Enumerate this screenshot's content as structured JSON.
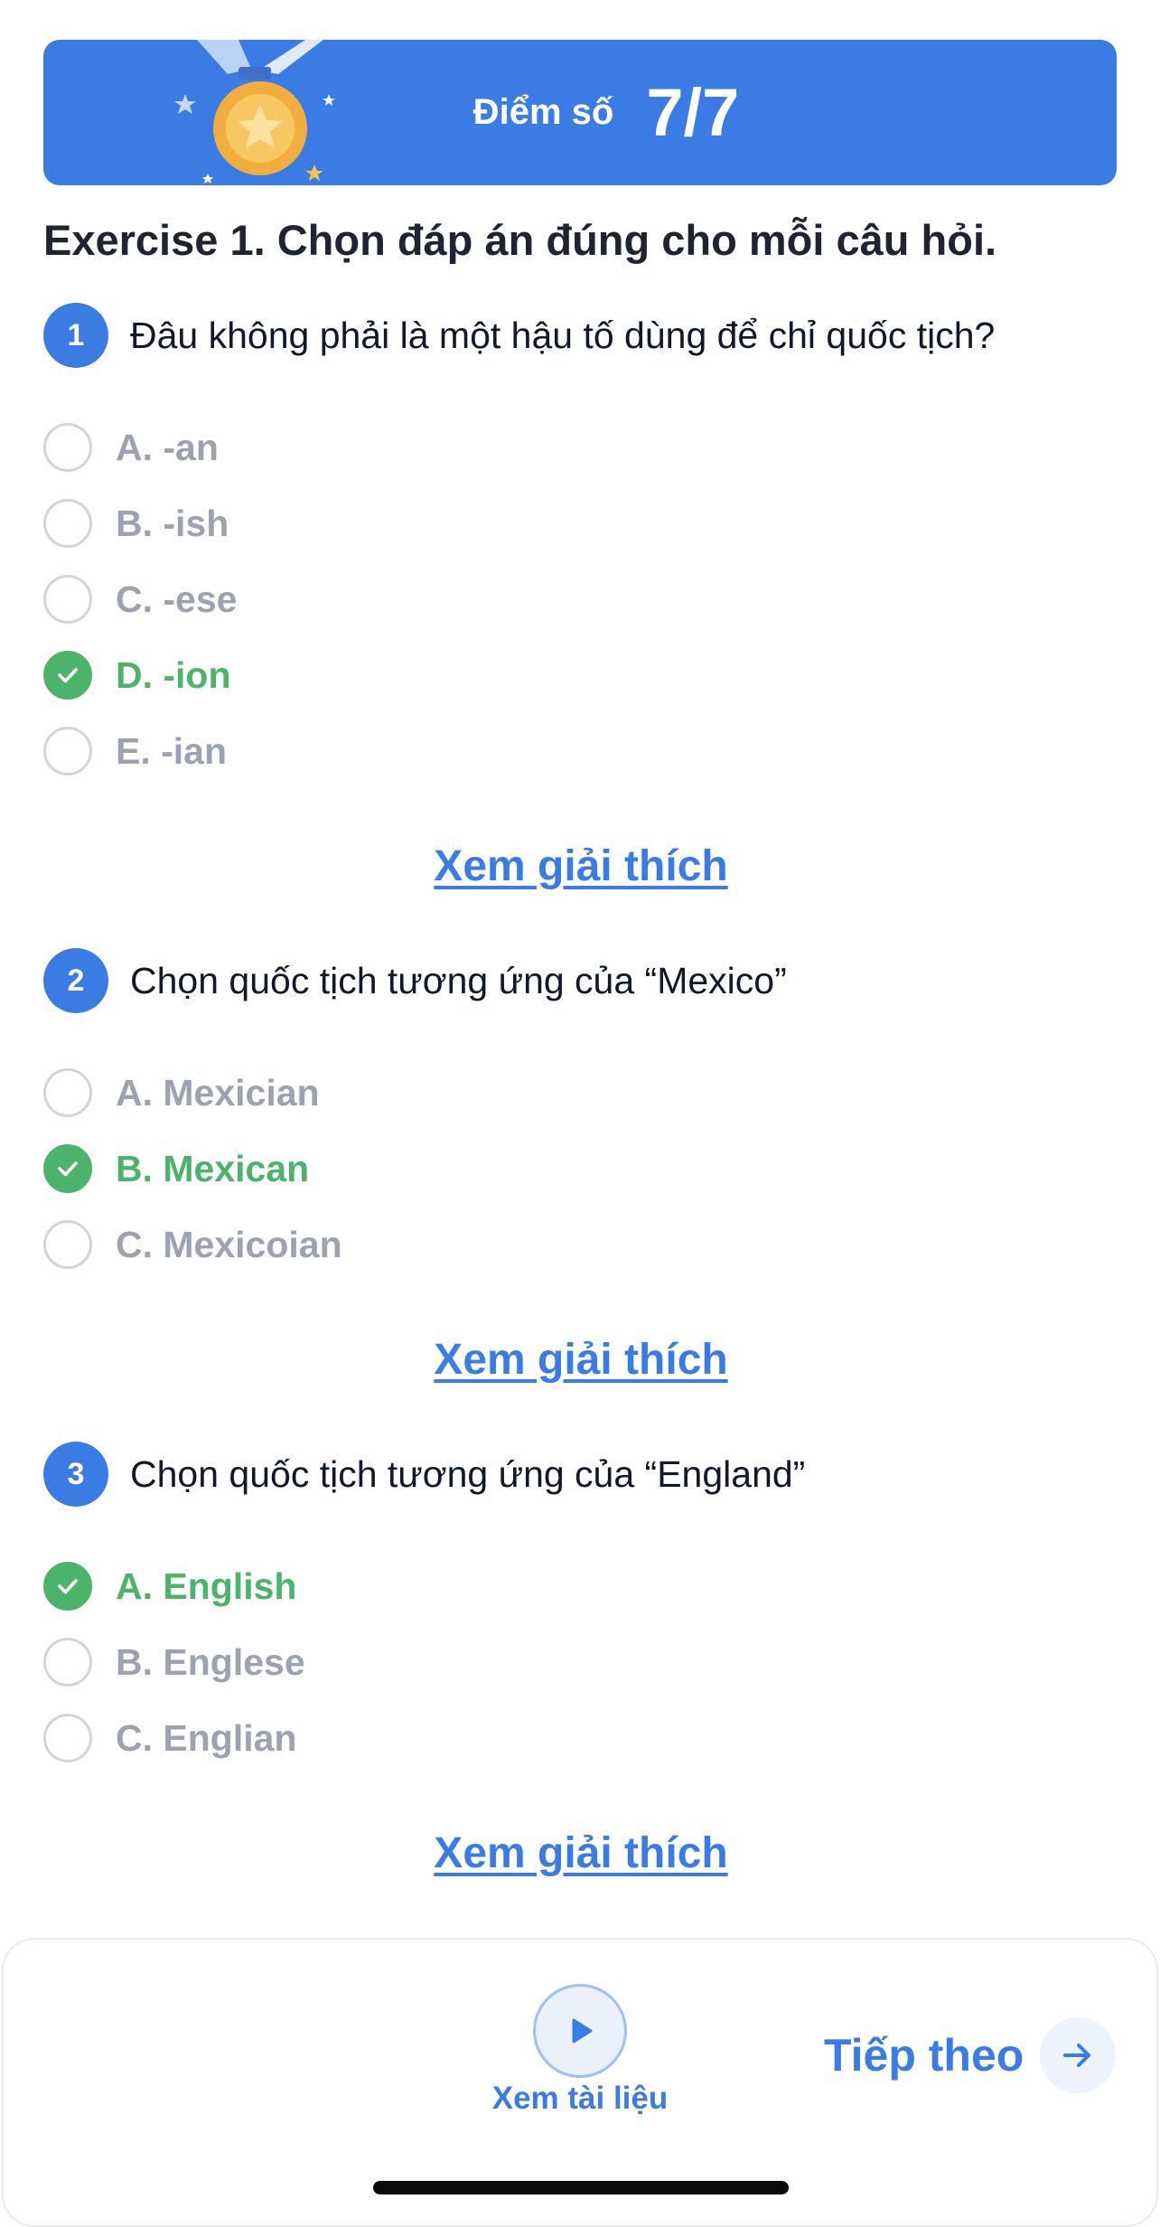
{
  "score": {
    "label": "Điểm số",
    "value": "7/7"
  },
  "exercise": {
    "title": "Exercise 1. Chọn đáp án đúng cho mỗi câu hỏi."
  },
  "questions": [
    {
      "number": "1",
      "text": "Đâu không phải là một hậu tố dùng để chỉ quốc tịch?",
      "options": [
        {
          "label": "A. -an",
          "correct": false
        },
        {
          "label": "B. -ish",
          "correct": false
        },
        {
          "label": "C. -ese",
          "correct": false
        },
        {
          "label": "D. -ion",
          "correct": true
        },
        {
          "label": "E. -ian",
          "correct": false
        }
      ],
      "explain_label": "Xem giải thích"
    },
    {
      "number": "2",
      "text": "Chọn quốc tịch tương ứng của “Mexico”",
      "options": [
        {
          "label": "A. Mexician",
          "correct": false
        },
        {
          "label": "B. Mexican",
          "correct": true
        },
        {
          "label": "C. Mexicoian",
          "correct": false
        }
      ],
      "explain_label": "Xem giải thích"
    },
    {
      "number": "3",
      "text": "Chọn quốc tịch tương ứng của “England”",
      "options": [
        {
          "label": "A. English",
          "correct": true
        },
        {
          "label": "B. Englese",
          "correct": false
        },
        {
          "label": "C. Englian",
          "correct": false
        }
      ],
      "explain_label": "Xem giải thích"
    }
  ],
  "footer": {
    "docs_label": "Xem tài liệu",
    "next_label": "Tiếp theo"
  },
  "colors": {
    "primary": "#3b7be4",
    "correct": "#4cb36a",
    "muted": "#9ca3af"
  },
  "icons": {
    "medal": "medal-icon",
    "play": "play-icon",
    "check": "check-icon",
    "next": "arrow-right-icon"
  }
}
